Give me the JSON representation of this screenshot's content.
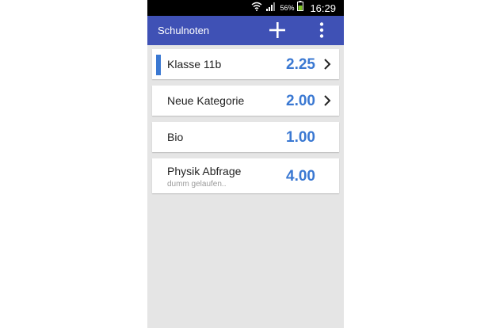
{
  "status_bar": {
    "battery_percent": "56%",
    "time": "16:29",
    "icons": [
      "wifi-icon",
      "signal-icon",
      "battery-icon"
    ]
  },
  "action_bar": {
    "title": "Schulnoten",
    "add_icon": "plus-icon",
    "menu_icon": "overflow-menu-icon",
    "color": "#3f51b5"
  },
  "items": [
    {
      "name": "Klasse 11b",
      "grade": "2.25",
      "subtitle": "",
      "selected": true,
      "has_chevron": true
    },
    {
      "name": "Neue Kategorie",
      "grade": "2.00",
      "subtitle": "",
      "selected": false,
      "has_chevron": true
    },
    {
      "name": "Bio",
      "grade": "1.00",
      "subtitle": "",
      "selected": false,
      "has_chevron": false
    },
    {
      "name": "Physik Abfrage",
      "grade": "4.00",
      "subtitle": "dumm gelaufen..",
      "selected": false,
      "has_chevron": false
    }
  ],
  "colors": {
    "accent": "#3a78d2",
    "background": "#e5e5e5"
  }
}
